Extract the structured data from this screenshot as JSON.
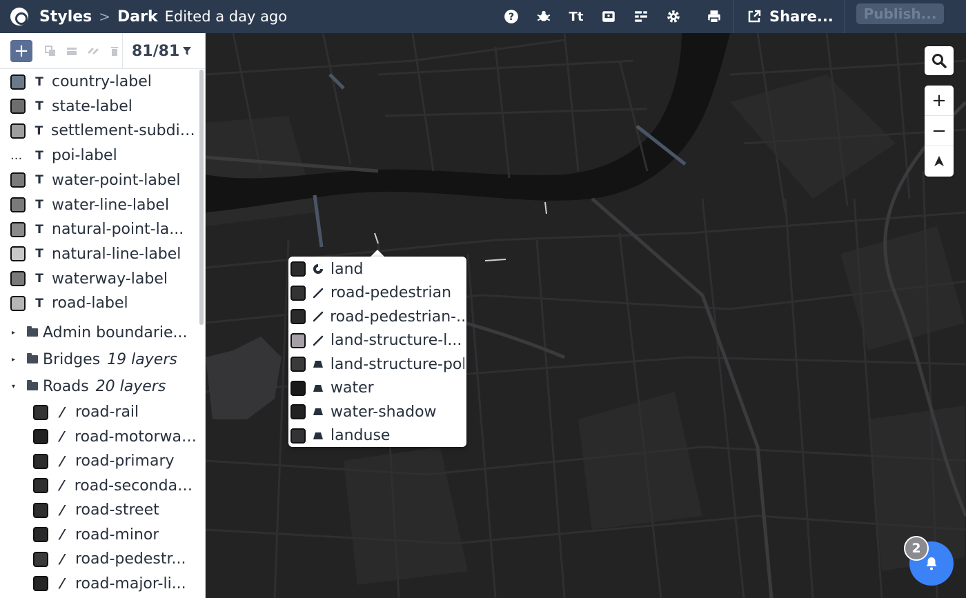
{
  "header": {
    "breadcrumb_root": "Styles",
    "breadcrumb_sep": ">",
    "style_name": "Dark",
    "edited": "Edited a day ago",
    "icons": [
      "help-icon",
      "debug-icon",
      "typography-icon",
      "preview-icon",
      "layer-settings-icon",
      "settings-icon",
      "print-icon"
    ],
    "typography_glyph": "Tt",
    "share_label": "Share...",
    "publish_label": "Publish..."
  },
  "sidebar": {
    "add_glyph": "+",
    "layer_count": "81/81",
    "type_glyph": "T",
    "poi_swatch": "...",
    "layers": [
      {
        "name": "country-label",
        "swatch": "#6b7a8a"
      },
      {
        "name": "state-label",
        "swatch": "#6e6e6e"
      },
      {
        "name": "settlement-subdivi...",
        "swatch": "#9e9e9e"
      },
      {
        "name": "poi-label",
        "swatch": "none"
      },
      {
        "name": "water-point-label",
        "swatch": "#7a7a7a"
      },
      {
        "name": "water-line-label",
        "swatch": "#7a7a7a"
      },
      {
        "name": "natural-point-la...",
        "swatch": "#8a8a8a"
      },
      {
        "name": "natural-line-label",
        "swatch": "#c8c8c8"
      },
      {
        "name": "waterway-label",
        "swatch": "#7a7a7a"
      },
      {
        "name": "road-label",
        "swatch": "#b5b5b5"
      }
    ],
    "groups": [
      {
        "name": "Admin boundarie...",
        "count": "",
        "expanded": false
      },
      {
        "name": "Bridges",
        "count": "19 layers",
        "expanded": false
      },
      {
        "name": "Roads",
        "count": "20 layers",
        "expanded": true
      }
    ],
    "roads": [
      {
        "name": "road-rail",
        "swatch": "#333333"
      },
      {
        "name": "road-motorway...",
        "swatch": "#222222"
      },
      {
        "name": "road-primary",
        "swatch": "#2c2c2c"
      },
      {
        "name": "road-secondary...",
        "swatch": "#2f2f2f"
      },
      {
        "name": "road-street",
        "swatch": "#2e2e2e"
      },
      {
        "name": "road-minor",
        "swatch": "#2a2a2a"
      },
      {
        "name": "road-pedestr...",
        "swatch": "#3a3a3a"
      },
      {
        "name": "road-major-li...",
        "swatch": "#262626"
      }
    ]
  },
  "popup": {
    "items": [
      {
        "name": "land",
        "icon": "fill-extrusion-icon",
        "swatch": "#2b2b2b"
      },
      {
        "name": "road-pedestrian",
        "icon": "line-icon",
        "swatch": "#333333"
      },
      {
        "name": "road-pedestrian-...",
        "icon": "line-icon",
        "swatch": "#2a2a2a"
      },
      {
        "name": "land-structure-l...",
        "icon": "line-icon",
        "swatch": "#a79fa8"
      },
      {
        "name": "land-structure-pol",
        "icon": "fill-icon",
        "swatch": "#3a3a3a"
      },
      {
        "name": "water",
        "icon": "fill-icon",
        "swatch": "#1a1a1a"
      },
      {
        "name": "water-shadow",
        "icon": "fill-icon",
        "swatch": "#222222"
      },
      {
        "name": "landuse",
        "icon": "fill-icon",
        "swatch": "#333336"
      }
    ]
  },
  "map_controls": {
    "search": "search-icon",
    "zoom_in": "+",
    "zoom_out": "−",
    "compass": "compass-icon"
  },
  "notifications": {
    "count": "2"
  },
  "colors": {
    "topbar": "#2b3a4f",
    "map_bg": "#232324",
    "water": "#131314",
    "notif": "#3b82f6"
  }
}
